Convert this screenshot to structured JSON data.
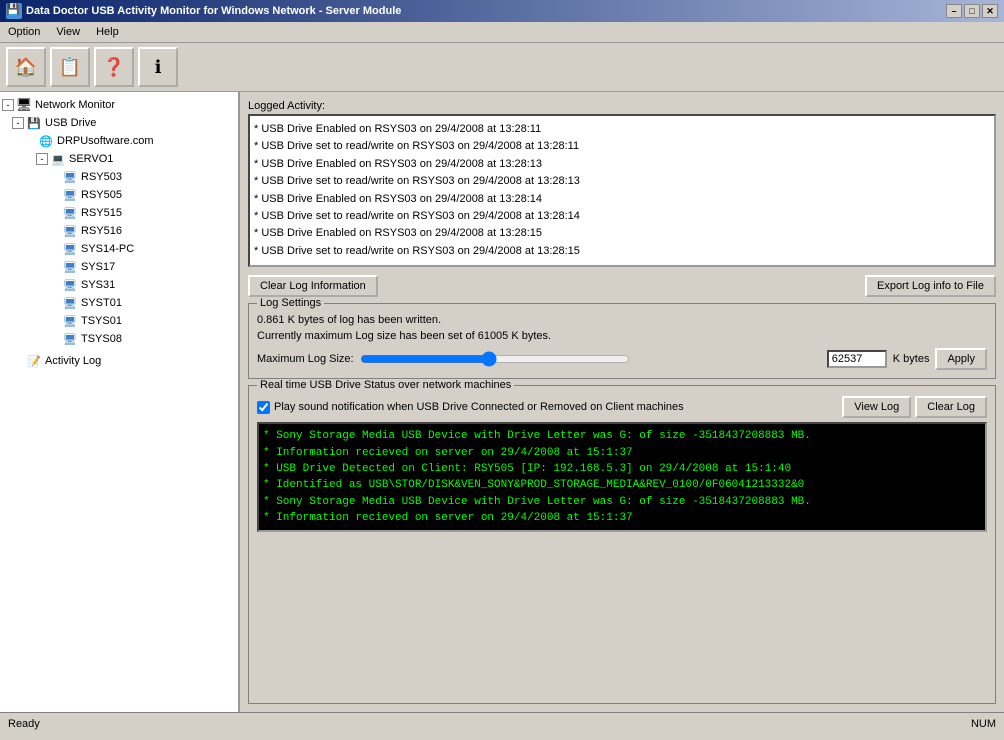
{
  "window": {
    "title": "Data Doctor USB Activity Monitor for Windows Network - Server Module",
    "controls": {
      "minimize": "–",
      "maximize": "□",
      "close": "✕"
    }
  },
  "menu": {
    "items": [
      "Option",
      "View",
      "Help"
    ]
  },
  "toolbar": {
    "buttons": [
      {
        "name": "home-button",
        "icon": "🏠"
      },
      {
        "name": "document-button",
        "icon": "📋"
      },
      {
        "name": "help-button",
        "icon": "❓"
      },
      {
        "name": "info-button",
        "icon": "ℹ"
      }
    ]
  },
  "tree": {
    "items": [
      {
        "level": 0,
        "label": "Network Monitor",
        "icon": "monitor",
        "expand": "-"
      },
      {
        "level": 1,
        "label": "USB Drive",
        "icon": "drive",
        "expand": "-"
      },
      {
        "level": 2,
        "label": "DRPUsoftware.com",
        "icon": "network",
        "expand": null
      },
      {
        "level": 3,
        "label": "SERVO1",
        "icon": "computer",
        "expand": "-"
      },
      {
        "level": 4,
        "label": "RSY503",
        "icon": "computer",
        "expand": null
      },
      {
        "level": 4,
        "label": "RSY505",
        "icon": "computer",
        "expand": null
      },
      {
        "level": 4,
        "label": "RSY515",
        "icon": "computer",
        "expand": null
      },
      {
        "level": 4,
        "label": "RSY516",
        "icon": "computer",
        "expand": null
      },
      {
        "level": 4,
        "label": "SYS14-PC",
        "icon": "computer",
        "expand": null
      },
      {
        "level": 4,
        "label": "SYS17",
        "icon": "computer",
        "expand": null
      },
      {
        "level": 4,
        "label": "SYS31",
        "icon": "computer",
        "expand": null
      },
      {
        "level": 4,
        "label": "SYST01",
        "icon": "computer",
        "expand": null
      },
      {
        "level": 4,
        "label": "TSYS01",
        "icon": "computer",
        "expand": null
      },
      {
        "level": 4,
        "label": "TSYS08",
        "icon": "computer",
        "expand": null
      },
      {
        "level": 1,
        "label": "Activity Log",
        "icon": "activity",
        "expand": null
      }
    ]
  },
  "logged_activity": {
    "label": "Logged Activity:",
    "entries": [
      "* USB Drive Enabled on RSYS03 on 29/4/2008 at 13:28:11",
      "* USB Drive set to read/write on RSYS03 on 29/4/2008 at 13:28:11",
      "* USB Drive Enabled on RSYS03 on 29/4/2008 at 13:28:13",
      "* USB Drive set to read/write on RSYS03 on 29/4/2008 at 13:28:13",
      "* USB Drive Enabled on RSYS03 on 29/4/2008 at 13:28:14",
      "* USB Drive set to read/write on RSYS03 on 29/4/2008 at 13:28:14",
      "* USB Drive Enabled on RSYS03 on 29/4/2008 at 13:28:15",
      "* USB Drive set to read/write on RSYS03 on 29/4/2008 at 13:28:15"
    ],
    "clear_log_btn": "Clear Log Information",
    "export_btn": "Export Log info to File"
  },
  "log_settings": {
    "title": "Log Settings",
    "line1": "0.861 K bytes of log has been written.",
    "line2": "Currently maximum Log size has been set of 61005 K bytes.",
    "max_log_label": "Maximum Log Size:",
    "max_log_value": "62537",
    "k_bytes_label": "K bytes",
    "apply_btn": "Apply"
  },
  "realtime": {
    "title": "Real time USB Drive Status over network machines",
    "checkbox_label": "Play sound notification when USB Drive Connected or Removed on Client machines",
    "view_log_btn": "View Log",
    "clear_log_btn": "Clear Log",
    "entries": [
      "* Sony Storage Media USB Device  with Drive Letter was G: of size -3518437208883 MB.",
      "* Information recieved on server on 29/4/2008 at 15:1:37",
      "",
      "* USB Drive Detected on Client: RSY505 [IP: 192.168.5.3] on 29/4/2008 at 15:1:40",
      "* Identified as USB\\STOR/DISK&VEN_SONY&PROD_STORAGE_MEDIA&REV_0100/0F06041213332&0",
      "* Sony Storage Media USB Device  with Drive Letter was G: of size -3518437208883 MB.",
      "* Information recieved on server on 29/4/2008 at 15:1:37"
    ]
  },
  "status_bar": {
    "left": "Ready",
    "right": "NUM"
  }
}
